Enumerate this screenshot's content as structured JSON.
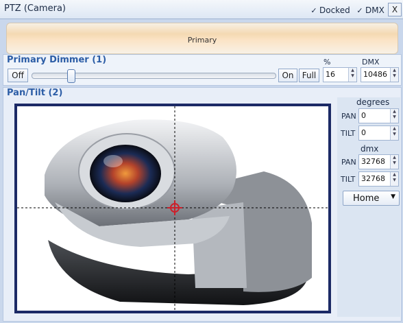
{
  "window": {
    "title": "PTZ (Camera)",
    "docked_label": "Docked",
    "dmx_label": "DMX",
    "close_label": "X",
    "check_mark": "✓"
  },
  "tab": {
    "label": "Primary"
  },
  "dimmer": {
    "title": "Primary Dimmer (1)",
    "percent_header": "%",
    "dmx_header": "DMX",
    "off_label": "Off",
    "on_label": "On",
    "full_label": "Full",
    "percent_value": "16",
    "dmx_value": "10486",
    "level_fraction": 0.16
  },
  "pantilt": {
    "title": "Pan/Tilt (2)",
    "degrees_header": "degrees",
    "dmx_header": "dmx",
    "pan_label": "PAN",
    "tilt_label": "TILT",
    "pan_degrees": "0",
    "tilt_degrees": "0",
    "pan_dmx": "32768",
    "tilt_dmx": "32768",
    "home_label": "Home",
    "crosshair_color": "#cc1f2a"
  }
}
